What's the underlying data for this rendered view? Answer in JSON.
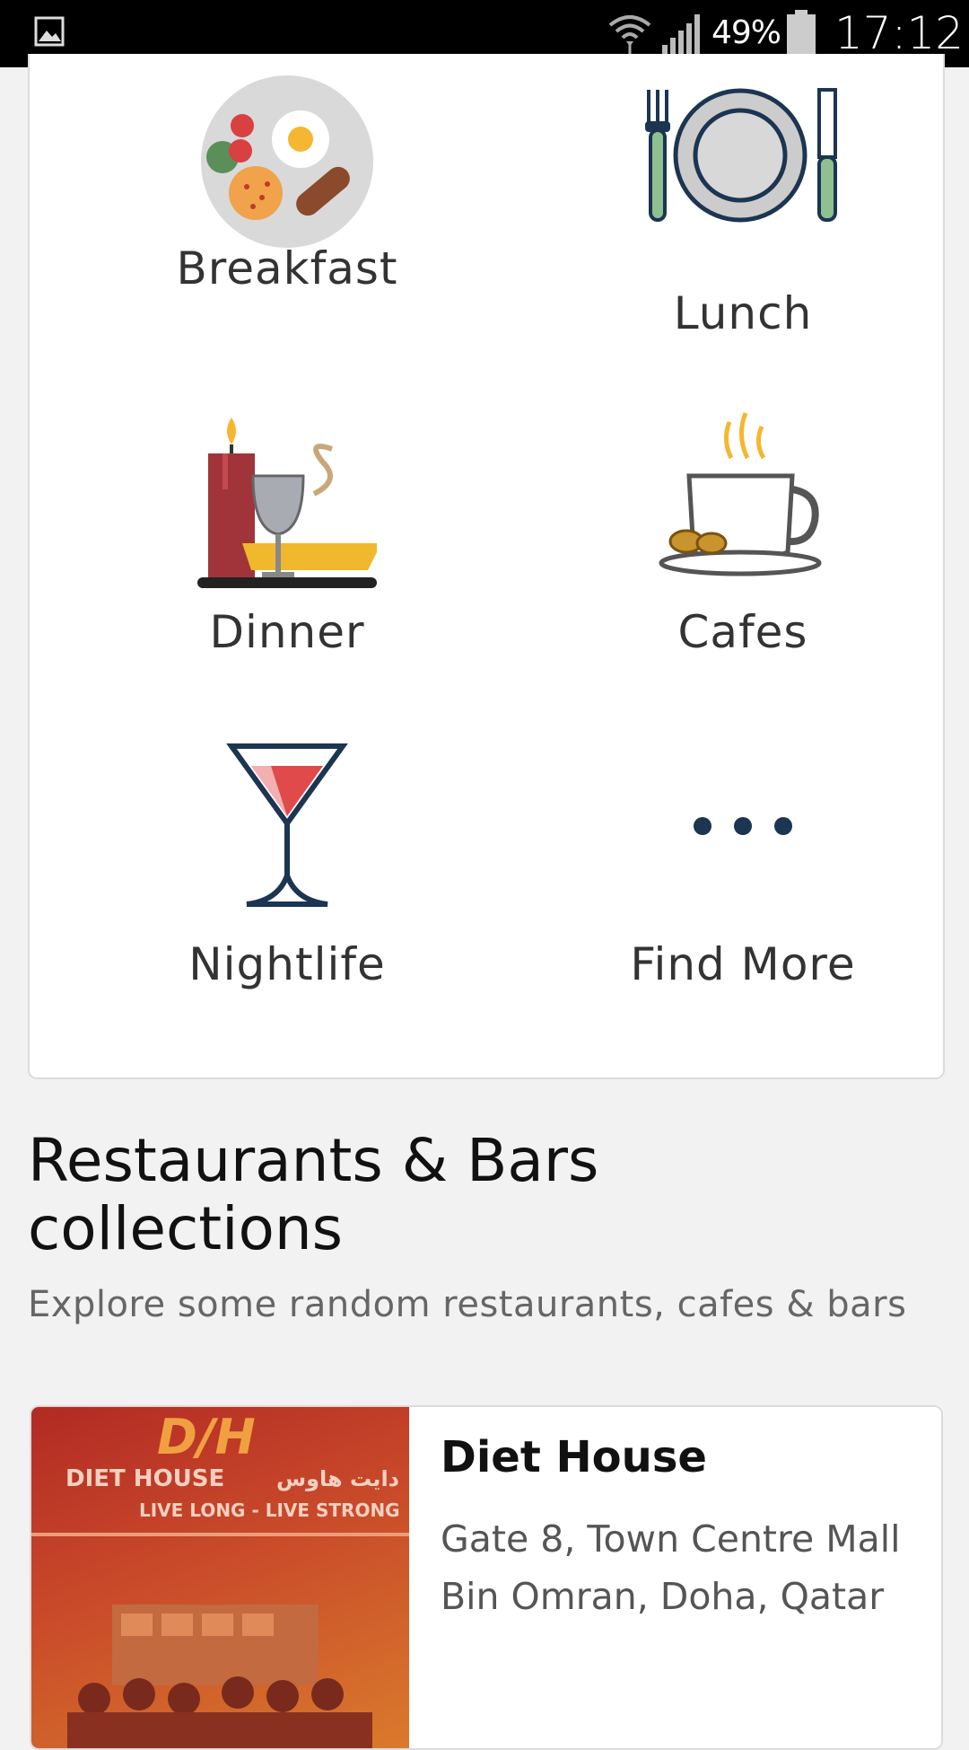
{
  "status_bar": {
    "battery_percent": "49%",
    "time": "17:12",
    "icons": [
      "image-notification-icon",
      "wifi-icon",
      "signal-icon",
      "battery-icon"
    ]
  },
  "categories": [
    {
      "label": "Breakfast",
      "icon": "breakfast-plate-icon"
    },
    {
      "label": "Lunch",
      "icon": "plate-fork-knife-icon"
    },
    {
      "label": "Dinner",
      "icon": "candle-wine-icon"
    },
    {
      "label": "Cafes",
      "icon": "coffee-cup-icon"
    },
    {
      "label": "Nightlife",
      "icon": "cocktail-glass-icon"
    },
    {
      "label": "Find More",
      "icon": "more-dots-icon"
    }
  ],
  "collections": {
    "title": "Restaurants & Bars collections",
    "subtitle": "Explore some random restaurants, cafes & bars"
  },
  "restaurants": [
    {
      "name": "Diet House",
      "address_line1": "Gate 8, Town Centre Mall",
      "address_line2": "Bin Omran, Doha, Qatar",
      "photo_sign": {
        "logo": "D/H",
        "name_en": "DIET HOUSE",
        "name_ar": "دايت هاوس",
        "slogan": "LIVE LONG - LIVE STRONG"
      }
    }
  ],
  "colors": {
    "accent_dark": "#1b3552",
    "accent_red": "#e04a4a",
    "photo_overlay": "#c0392b"
  }
}
